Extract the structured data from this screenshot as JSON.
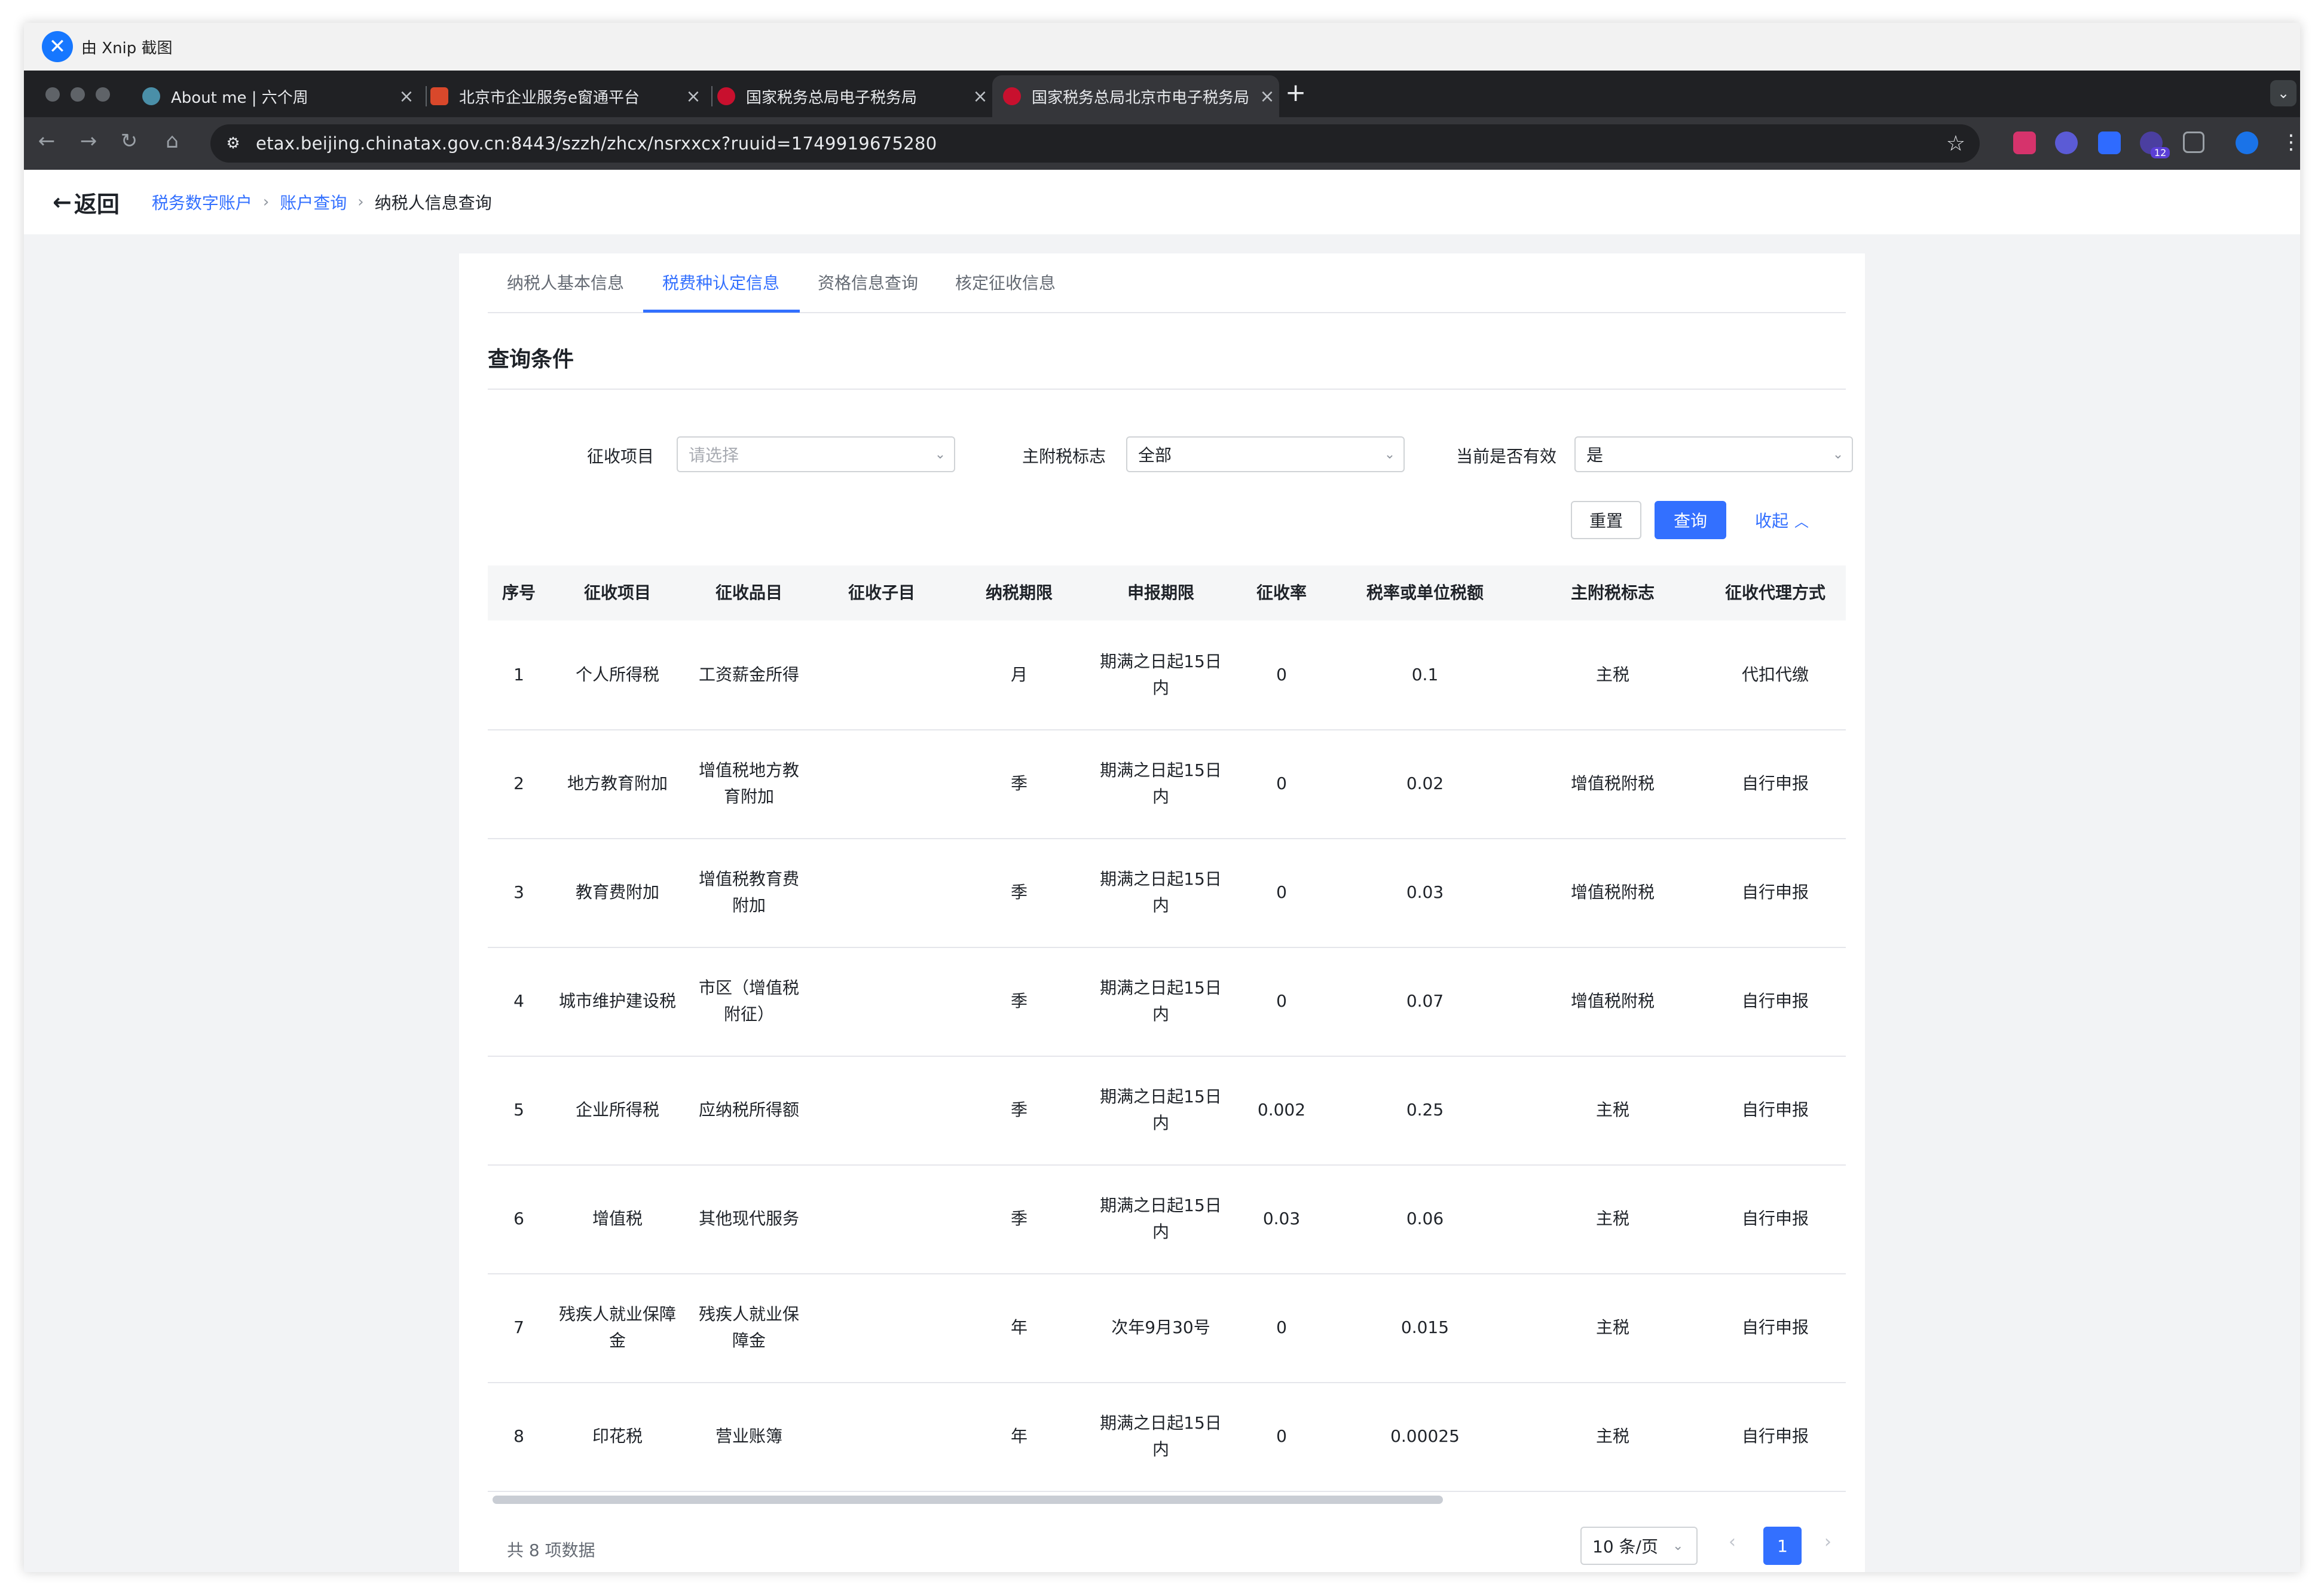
{
  "xnip": {
    "title": "由 Xnip 截图"
  },
  "browser": {
    "tabs": [
      {
        "title": "About me | 六个周",
        "active": false
      },
      {
        "title": "北京市企业服务e窗通平台",
        "active": false
      },
      {
        "title": "国家税务总局电子税务局",
        "active": false
      },
      {
        "title": "国家税务总局北京市电子税务局",
        "active": true
      }
    ],
    "new_tab": "+",
    "url": "etax.beijing.chinatax.gov.cn:8443/szzh/zhcx/nsrxxcx?ruuid=1749919675280",
    "extension_badge": "12"
  },
  "header": {
    "back_label": "返回",
    "breadcrumb": [
      "税务数字账户",
      "账户查询",
      "纳税人信息查询"
    ]
  },
  "page_tabs": [
    "纳税人基本信息",
    "税费种认定信息",
    "资格信息查询",
    "核定征收信息"
  ],
  "active_tab_index": 1,
  "query": {
    "title": "查询条件",
    "fields": [
      {
        "label": "征收项目",
        "value": "",
        "placeholder": "请选择"
      },
      {
        "label": "主附税标志",
        "value": "全部"
      },
      {
        "label": "当前是否有效",
        "value": "是"
      }
    ],
    "reset_label": "重置",
    "search_label": "查询",
    "collapse_label": "收起"
  },
  "table": {
    "columns": [
      "序号",
      "征收项目",
      "征收品目",
      "征收子目",
      "纳税期限",
      "申报期限",
      "征收率",
      "税率或单位税额",
      "主附税标志",
      "征收代理方式"
    ],
    "rows": [
      [
        "1",
        "个人所得税",
        "工资薪金所得",
        "",
        "月",
        "期满之日起15日内",
        "0",
        "0.1",
        "主税",
        "代扣代缴"
      ],
      [
        "2",
        "地方教育附加",
        "增值税地方教育附加",
        "",
        "季",
        "期满之日起15日内",
        "0",
        "0.02",
        "增值税附税",
        "自行申报"
      ],
      [
        "3",
        "教育费附加",
        "增值税教育费附加",
        "",
        "季",
        "期满之日起15日内",
        "0",
        "0.03",
        "增值税附税",
        "自行申报"
      ],
      [
        "4",
        "城市维护建设税",
        "市区（增值税附征）",
        "",
        "季",
        "期满之日起15日内",
        "0",
        "0.07",
        "增值税附税",
        "自行申报"
      ],
      [
        "5",
        "企业所得税",
        "应纳税所得额",
        "",
        "季",
        "期满之日起15日内",
        "0.002",
        "0.25",
        "主税",
        "自行申报"
      ],
      [
        "6",
        "增值税",
        "其他现代服务",
        "",
        "季",
        "期满之日起15日内",
        "0.03",
        "0.06",
        "主税",
        "自行申报"
      ],
      [
        "7",
        "残疾人就业保障金",
        "残疾人就业保障金",
        "",
        "年",
        "次年9月30号",
        "0",
        "0.015",
        "主税",
        "自行申报"
      ],
      [
        "8",
        "印花税",
        "营业账簿",
        "",
        "年",
        "期满之日起15日内",
        "0",
        "0.00025",
        "主税",
        "自行申报"
      ]
    ]
  },
  "pagination": {
    "total_text": "共 8 项数据",
    "page_size": "10 条/页",
    "current_page": "1"
  },
  "colors": {
    "accent": "#3370ff",
    "chrome_dark": "#202124",
    "page_bg": "#f2f3f5"
  }
}
